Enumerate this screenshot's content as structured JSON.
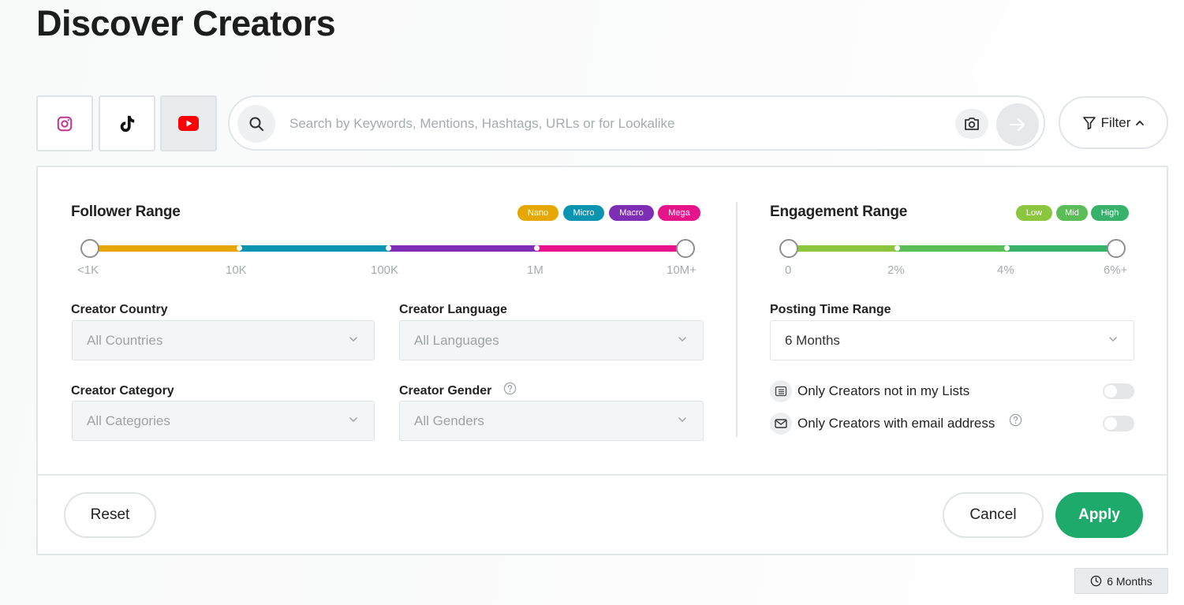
{
  "page": {
    "title": "Discover Creators"
  },
  "platforms": [
    {
      "name": "Instagram",
      "icon": "instagram-icon",
      "active": false
    },
    {
      "name": "TikTok",
      "icon": "tiktok-icon",
      "active": false
    },
    {
      "name": "YouTube",
      "icon": "youtube-icon",
      "active": true
    }
  ],
  "search": {
    "placeholder": "Search by Keywords, Mentions, Hashtags, URLs or for Lookalike"
  },
  "filter_button": {
    "label": "Filter"
  },
  "follower_range": {
    "title": "Follower Range",
    "pills": [
      {
        "label": "Nano",
        "color": "#e6a800"
      },
      {
        "label": "Micro",
        "color": "#0a94b0"
      },
      {
        "label": "Macro",
        "color": "#7d2eb5"
      },
      {
        "label": "Mega",
        "color": "#e6138a"
      }
    ],
    "ticks": [
      "<1K",
      "10K",
      "100K",
      "1M",
      "10M+"
    ],
    "selected_min": "<1K",
    "selected_max": "10M+"
  },
  "engagement_range": {
    "title": "Engagement Range",
    "pills": [
      {
        "label": "Low",
        "color": "#8cc63f"
      },
      {
        "label": "Mid",
        "color": "#5bbd58"
      },
      {
        "label": "High",
        "color": "#38b26b"
      }
    ],
    "ticks": [
      "0",
      "2%",
      "4%",
      "6%+"
    ],
    "selected_min": "0",
    "selected_max": "6%+"
  },
  "fields": {
    "country": {
      "label": "Creator Country",
      "value": "All Countries"
    },
    "language": {
      "label": "Creator Language",
      "value": "All Languages"
    },
    "category": {
      "label": "Creator Category",
      "value": "All Categories"
    },
    "gender": {
      "label": "Creator Gender",
      "value": "All Genders"
    },
    "posting_time": {
      "label": "Posting Time Range",
      "value": "6 Months"
    }
  },
  "toggles": [
    {
      "label": "Only Creators not in my Lists",
      "on": false
    },
    {
      "label": "Only Creators with email address",
      "on": false
    }
  ],
  "actions": {
    "reset": "Reset",
    "cancel": "Cancel",
    "apply": "Apply"
  },
  "time_chip": {
    "label": "6 Months"
  },
  "colors": {
    "accent": "#1eaa6a"
  }
}
